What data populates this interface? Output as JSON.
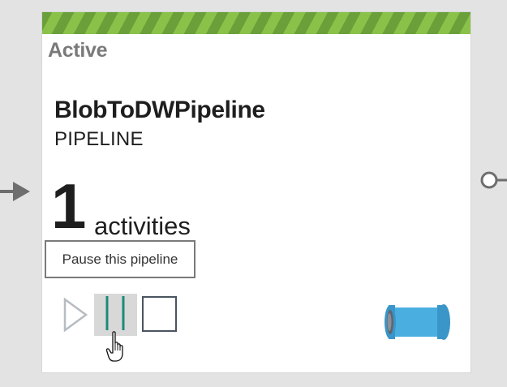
{
  "pipeline": {
    "status": "Active",
    "name": "BlobToDWPipeline",
    "type": "PIPELINE",
    "activity_count": "1",
    "activity_label": "activities"
  },
  "tooltip": {
    "text": "Pause this pipeline"
  },
  "controls": {
    "play_icon": "play-icon",
    "pause_icon": "pause-icon",
    "stop_icon": "stop-icon"
  },
  "colors": {
    "status_stripe_light": "#8ac249",
    "status_stripe_dark": "#6a9f3a",
    "pause_bar": "#1e8a78",
    "pipe_blue": "#4aaee0",
    "stop_border": "#4a5460"
  },
  "icons": {
    "pipeline": "pipe-icon",
    "cursor": "hand-cursor-icon",
    "input_arrow": "arrow-right-icon",
    "output_connector": "connector-circle-icon"
  }
}
